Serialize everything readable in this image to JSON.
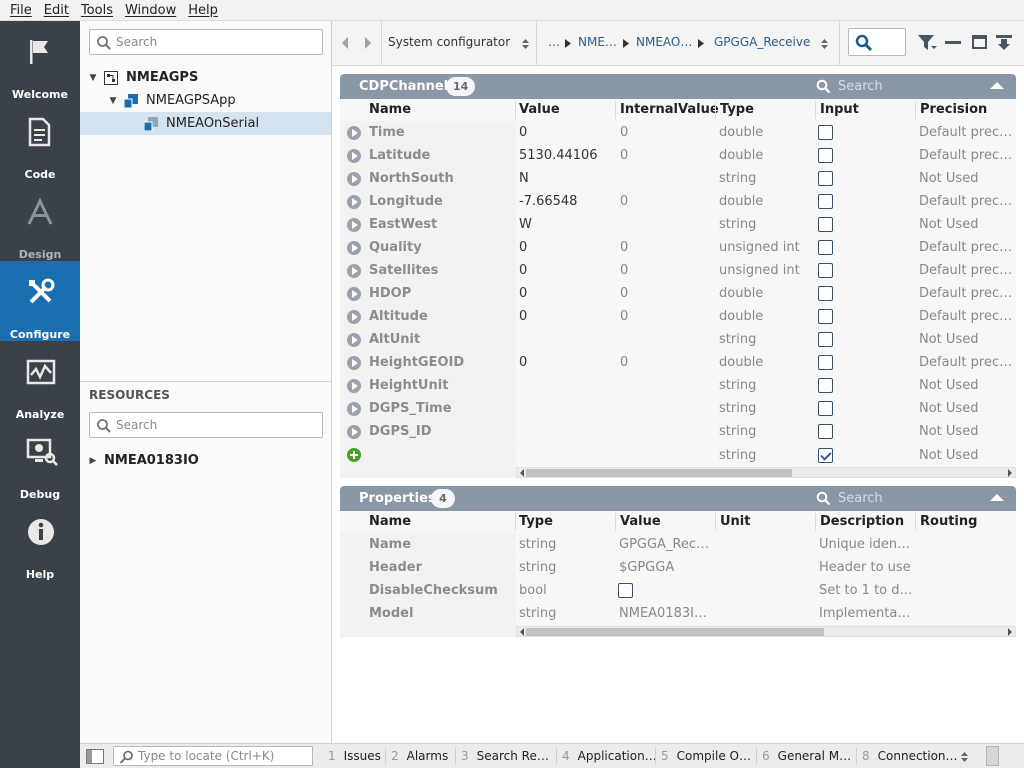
{
  "menu": [
    "File",
    "Edit",
    "Tools",
    "Window",
    "Help"
  ],
  "leftbar": [
    {
      "label": "Welcome",
      "icon": "flag-icon"
    },
    {
      "label": "Code",
      "icon": "document-icon"
    },
    {
      "label": "Design",
      "icon": "design-icon"
    },
    {
      "label": "Configure",
      "icon": "tools-icon"
    },
    {
      "label": "Analyze",
      "icon": "chart-icon"
    },
    {
      "label": "Debug",
      "icon": "bug-monitor-icon"
    },
    {
      "label": "Help",
      "icon": "info-icon"
    }
  ],
  "tree": {
    "search_placeholder": "Search",
    "nodes": [
      "NMEAGPS",
      "NMEAGPSApp",
      "NMEAOnSerial"
    ],
    "resources_title": "RESOURCES",
    "resources_search_placeholder": "Search",
    "resource_nodes": [
      "NMEA0183IO"
    ]
  },
  "toolbar": {
    "mode": "System configurator",
    "breadcrumb": [
      "…",
      "NME…",
      "NMEAO…",
      "GPGGA_Receive"
    ]
  },
  "channel_panel": {
    "title": "CDPChannel",
    "count": "14",
    "search_placeholder": "Search",
    "columns": [
      "Name",
      "Value",
      "InternalValue",
      "Type",
      "Input",
      "Precision"
    ],
    "rows": [
      {
        "name": "Time",
        "value": "0",
        "internal": "0",
        "type": "double",
        "input": false,
        "precision": "Default precis…"
      },
      {
        "name": "Latitude",
        "value": "5130.44106",
        "internal": "0",
        "type": "double",
        "input": false,
        "precision": "Default precis…"
      },
      {
        "name": "NorthSouth",
        "value": "N",
        "internal": "",
        "type": "string",
        "input": false,
        "precision": "Not Used"
      },
      {
        "name": "Longitude",
        "value": "-7.66548",
        "internal": "0",
        "type": "double",
        "input": false,
        "precision": "Default precis…"
      },
      {
        "name": "EastWest",
        "value": "W",
        "internal": "",
        "type": "string",
        "input": false,
        "precision": "Not Used"
      },
      {
        "name": "Quality",
        "value": "0",
        "internal": "0",
        "type": "unsigned int",
        "input": false,
        "precision": "Default precis…"
      },
      {
        "name": "Satellites",
        "value": "0",
        "internal": "0",
        "type": "unsigned int",
        "input": false,
        "precision": "Default precis…"
      },
      {
        "name": "HDOP",
        "value": "0",
        "internal": "0",
        "type": "double",
        "input": false,
        "precision": "Default precis…"
      },
      {
        "name": "Altitude",
        "value": "0",
        "internal": "0",
        "type": "double",
        "input": false,
        "precision": "Default precis…"
      },
      {
        "name": "AltUnit",
        "value": "",
        "internal": "",
        "type": "string",
        "input": false,
        "precision": "Not Used"
      },
      {
        "name": "HeightGEOID",
        "value": "0",
        "internal": "0",
        "type": "double",
        "input": false,
        "precision": "Default precis…"
      },
      {
        "name": "HeightUnit",
        "value": "",
        "internal": "",
        "type": "string",
        "input": false,
        "precision": "Not Used"
      },
      {
        "name": "DGPS_Time",
        "value": "",
        "internal": "",
        "type": "string",
        "input": false,
        "precision": "Not Used"
      },
      {
        "name": "DGPS_ID",
        "value": "",
        "internal": "",
        "type": "string",
        "input": false,
        "precision": "Not Used"
      }
    ],
    "new_row": {
      "type": "string",
      "input": true,
      "precision": "Not Used"
    }
  },
  "properties_panel": {
    "title": "Properties",
    "count": "4",
    "search_placeholder": "Search",
    "columns": [
      "Name",
      "Type",
      "Value",
      "Unit",
      "Description",
      "Routing"
    ],
    "rows": [
      {
        "name": "Name",
        "type": "string",
        "value": "GPGGA_Rec…",
        "unit": "",
        "description": "Unique identif…",
        "routing": ""
      },
      {
        "name": "Header",
        "type": "string",
        "value": "$GPGGA",
        "unit": "",
        "description": "Header to use",
        "routing": ""
      },
      {
        "name": "DisableChecksum",
        "type": "bool",
        "value": "",
        "unit": "",
        "description": "Set to 1 to dis…",
        "routing": ""
      },
      {
        "name": "Model",
        "type": "string",
        "value": "NMEA0183IO…",
        "unit": "",
        "description": "Implementati…",
        "routing": ""
      }
    ]
  },
  "statusbar": {
    "locate_placeholder": "Type to locate (Ctrl+K)",
    "tabs": [
      {
        "num": "1",
        "label": "Issues"
      },
      {
        "num": "2",
        "label": "Alarms"
      },
      {
        "num": "3",
        "label": "Search Re…"
      },
      {
        "num": "4",
        "label": "Application…"
      },
      {
        "num": "5",
        "label": "Compile O…"
      },
      {
        "num": "6",
        "label": "General M…"
      },
      {
        "num": "8",
        "label": "Connection…"
      }
    ]
  },
  "colors": {
    "accent": "#1a6fb0",
    "leftbar": "#3b4149",
    "panel_header": "#8a97a6",
    "selection": "#d5e3f1"
  }
}
